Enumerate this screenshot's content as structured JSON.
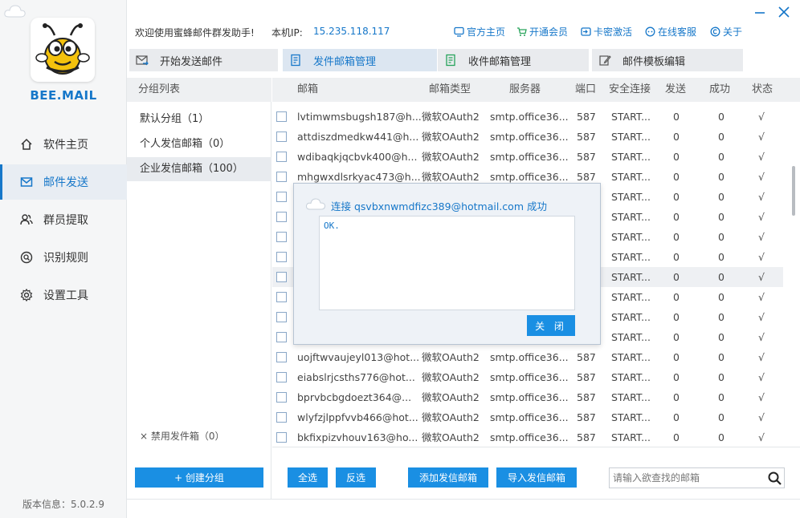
{
  "app": {
    "logo_text": "BEE.MAIL",
    "version": "版本信息：5.0.2.9",
    "accent": "#1677c9",
    "button_color": "#1a8fe3"
  },
  "nav": [
    {
      "label": "软件主页",
      "icon": "home-icon"
    },
    {
      "label": "邮件发送",
      "icon": "mail-icon",
      "active": true
    },
    {
      "label": "群员提取",
      "icon": "users-icon"
    },
    {
      "label": "识别规则",
      "icon": "rule-icon"
    },
    {
      "label": "设置工具",
      "icon": "gear-icon"
    }
  ],
  "infobar": {
    "welcome": "欢迎使用蜜蜂邮件群发助手!",
    "ip_label": "本机IP:",
    "ip_value": "15.235.118.117",
    "links": [
      "官方主页",
      "开通会员",
      "卡密激活",
      "在线客服",
      "关于"
    ]
  },
  "tabs": [
    "开始发送邮件",
    "发件邮箱管理",
    "收件邮箱管理",
    "邮件模板编辑"
  ],
  "groups": {
    "header": "分组列表",
    "items": [
      "默认分组（1）",
      "个人发信邮箱（0）",
      "企业发信邮箱（100）"
    ],
    "disabled": "× 禁用发件箱（0）",
    "create_button": "+ 创建分组"
  },
  "table": {
    "headers": [
      "邮箱",
      "邮箱类型",
      "服务器",
      "端口",
      "安全连接",
      "发送",
      "成功",
      "状态"
    ],
    "rows": [
      [
        "lvtimwmsbugsh187@h...",
        "微软OAuth2",
        "smtp.office36...",
        "587",
        "START...",
        "0",
        "0",
        "√"
      ],
      [
        "attdiszdmedkw441@h...",
        "微软OAuth2",
        "smtp.office36...",
        "587",
        "START...",
        "0",
        "0",
        "√"
      ],
      [
        "wdibaqkjqcbvk400@h...",
        "微软OAuth2",
        "smtp.office36...",
        "587",
        "START...",
        "0",
        "0",
        "√"
      ],
      [
        "mhgwxdlsrkyac473@h...",
        "微软OAuth2",
        "smtp.office36...",
        "587",
        "START...",
        "0",
        "0",
        "√"
      ],
      [
        "",
        "",
        "",
        "",
        "START...",
        "0",
        "0",
        "√"
      ],
      [
        "",
        "",
        "",
        "",
        "START...",
        "0",
        "0",
        "√"
      ],
      [
        "",
        "",
        "",
        "",
        "START...",
        "0",
        "0",
        "√"
      ],
      [
        "",
        "",
        "",
        "",
        "START...",
        "0",
        "0",
        "√"
      ],
      [
        "",
        "",
        "",
        "",
        "START...",
        "0",
        "0",
        "√"
      ],
      [
        "",
        "",
        "",
        "",
        "START...",
        "0",
        "0",
        "√"
      ],
      [
        "",
        "",
        "",
        "",
        "START...",
        "0",
        "0",
        "√"
      ],
      [
        "",
        "",
        "",
        "",
        "START...",
        "0",
        "0",
        "√"
      ],
      [
        "uojftwvaujeyl013@hot...",
        "微软OAuth2",
        "smtp.office36...",
        "587",
        "START...",
        "0",
        "0",
        "√"
      ],
      [
        "eiabslrjcsths776@hot...",
        "微软OAuth2",
        "smtp.office36...",
        "587",
        "START...",
        "0",
        "0",
        "√"
      ],
      [
        "bprvbcbgdoezt364@...",
        "微软OAuth2",
        "smtp.office36...",
        "587",
        "START...",
        "0",
        "0",
        "√"
      ],
      [
        "wlyfzjlppfvvb466@hot...",
        "微软OAuth2",
        "smtp.office36...",
        "587",
        "START...",
        "0",
        "0",
        "√"
      ],
      [
        "bkfixpizvhouv163@ho...",
        "微软OAuth2",
        "smtp.office36...",
        "587",
        "START...",
        "0",
        "0",
        "√"
      ]
    ]
  },
  "toolbar": {
    "select_all": "全选",
    "invert": "反选",
    "add_sender": "添加发信邮箱",
    "import_sender": "导入发信邮箱",
    "search_placeholder": "请输入欲查找的邮箱"
  },
  "dialog": {
    "title": "连接 qsvbxnwmdfizc389@hotmail.com 成功",
    "body": "OK.",
    "close": "关 闭"
  }
}
